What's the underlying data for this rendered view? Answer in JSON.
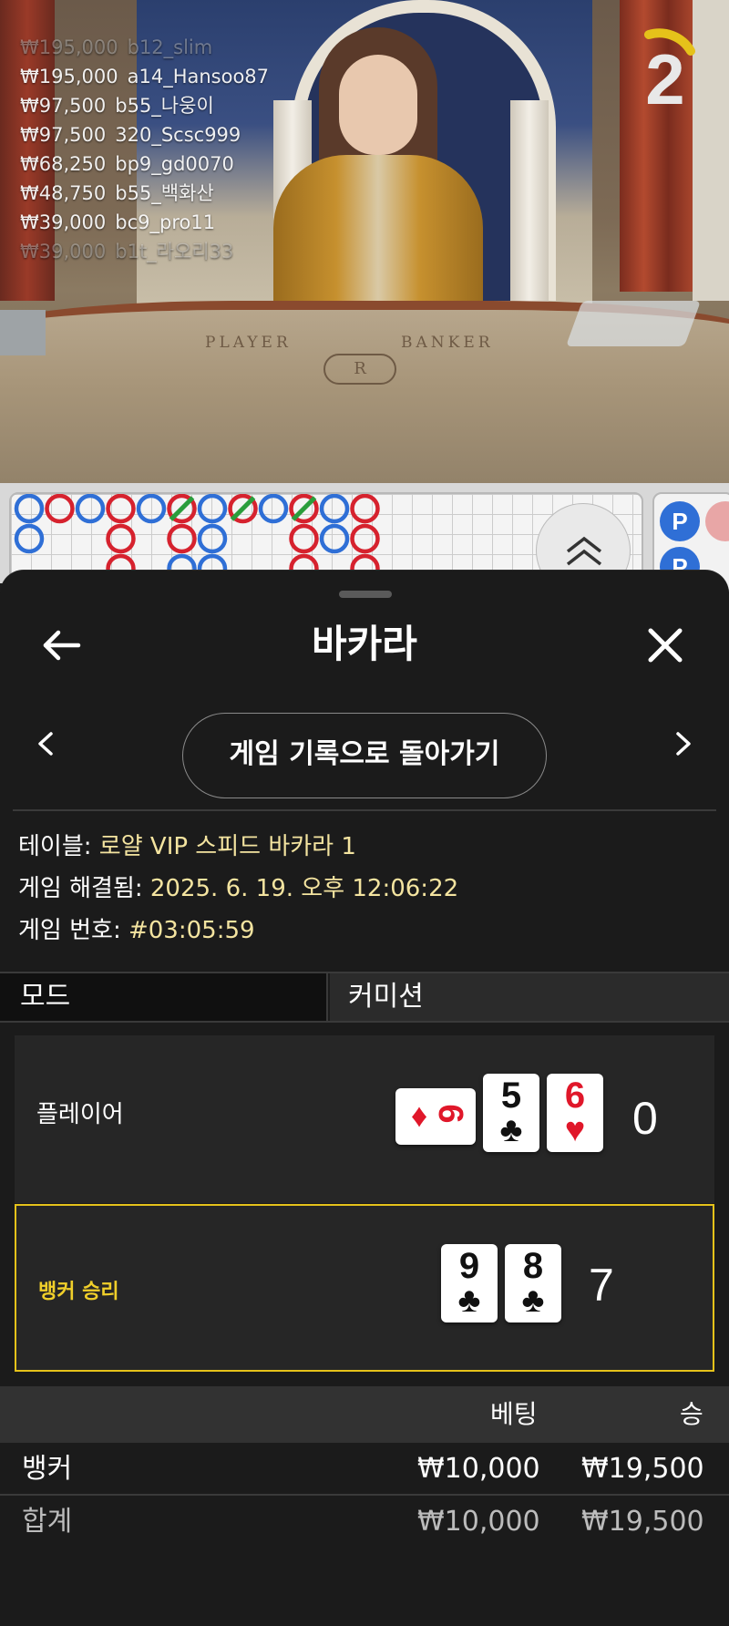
{
  "video": {
    "table_labels": {
      "player": "PLAYER",
      "banker": "BANKER"
    },
    "chat": [
      {
        "amount": "₩195,000",
        "user": "b12_slim",
        "faded": true
      },
      {
        "amount": "₩195,000",
        "user": "a14_Hansoo87",
        "faded": false
      },
      {
        "amount": "₩97,500",
        "user": "b55_나웅이",
        "faded": false
      },
      {
        "amount": "₩97,500",
        "user": "320_Scsc999",
        "faded": false
      },
      {
        "amount": "₩68,250",
        "user": "bp9_gd0070",
        "faded": false
      },
      {
        "amount": "₩48,750",
        "user": "b55_백화산",
        "faded": false
      },
      {
        "amount": "₩39,000",
        "user": "bc9_pro11",
        "faded": false
      },
      {
        "amount": "₩39,000",
        "user": "b1t_라오리33",
        "faded": true
      }
    ],
    "timer": {
      "seconds": "2",
      "color": "#e5c21a"
    }
  },
  "roadmap": {
    "bead_columns": [
      [
        "B",
        "B"
      ],
      [
        "R"
      ],
      [
        "B"
      ],
      [
        "R",
        "R",
        "R"
      ],
      [
        "B"
      ],
      [
        "R",
        "R",
        "B"
      ],
      [
        "B",
        "B",
        "B"
      ],
      [
        "R"
      ],
      [
        "B"
      ],
      [
        "R",
        "R",
        "R"
      ],
      [
        "B",
        "B"
      ],
      [
        "R",
        "R",
        "R"
      ]
    ],
    "tie_marks": [
      5,
      7,
      9
    ],
    "predictor": [
      "P",
      "P"
    ],
    "colors": {
      "banker": "#d6222e",
      "player": "#2f6fd6",
      "tie": "#2a9d3c"
    }
  },
  "sheet": {
    "title": "바카라",
    "history_button": "게임 기록으로 돌아가기",
    "info": {
      "table_label": "테이블: ",
      "table_value": "로얄 VIP 스피드 바카라 1",
      "resolved_label": "게임 해결됨: ",
      "resolved_value": "2025. 6. 19. 오후 12:06:22",
      "number_label": "게임 번호: ",
      "number_value": "#03:05:59"
    },
    "tabs": {
      "mode": "모드",
      "commission": "커미션"
    },
    "player": {
      "label": "플레이어",
      "score": "0",
      "cards": [
        {
          "rank": "6",
          "suit": "♦",
          "color": "red",
          "sideways": true
        },
        {
          "rank": "5",
          "suit": "♣",
          "color": "black",
          "sideways": false
        },
        {
          "rank": "6",
          "suit": "♥",
          "color": "red",
          "sideways": false
        }
      ]
    },
    "banker": {
      "label": "뱅커 승리",
      "score": "7",
      "cards": [
        {
          "rank": "9",
          "suit": "♣",
          "color": "black",
          "sideways": false
        },
        {
          "rank": "8",
          "suit": "♣",
          "color": "black",
          "sideways": false
        }
      ]
    },
    "bets": {
      "header": {
        "bet": "베팅",
        "win": "승"
      },
      "rows": [
        {
          "name": "뱅커",
          "bet": "₩10,000",
          "win": "₩19,500"
        }
      ],
      "total": {
        "name": "합계",
        "bet": "₩10,000",
        "win": "₩19,500"
      }
    }
  }
}
